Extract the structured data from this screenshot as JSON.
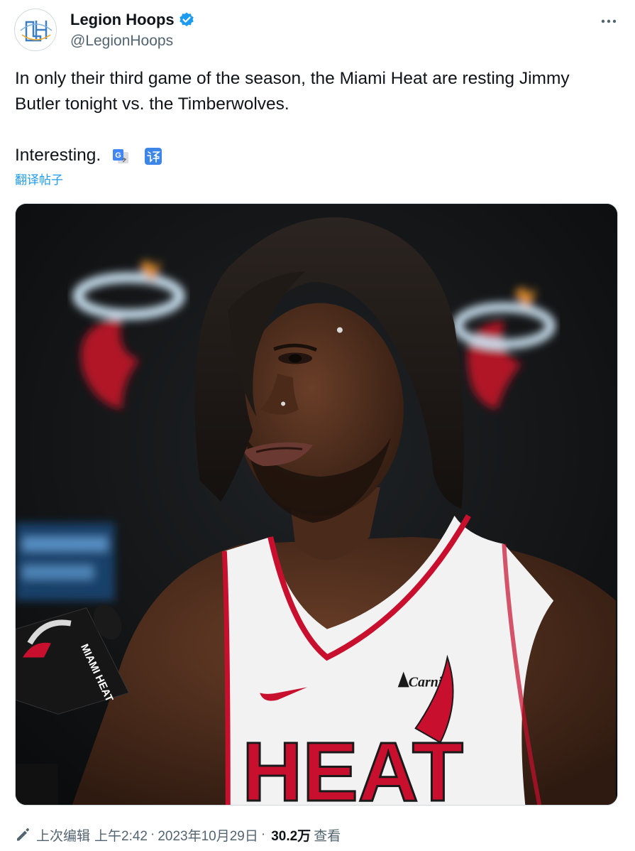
{
  "tweet": {
    "author": {
      "display_name": "Legion Hoops",
      "handle": "@LegionHoops",
      "avatar_text": "LH",
      "verified": true
    },
    "text_line1": "In only their third game of the season, the Miami Heat are resting Jimmy Butler tonight vs. the Timberwolves.",
    "text_line2": "Interesting.",
    "translate_link": "翻译帖子",
    "image_text": {
      "mic_flag": "MIAMI HEAT",
      "jersey_sponsor": "Carniv",
      "jersey_wordmark": "HEAT"
    },
    "meta": {
      "edited_label": "上次编辑",
      "time": "上午2:42",
      "dot": "·",
      "date": "2023年10月29日",
      "views_count": "30.2万",
      "views_label": "查看"
    }
  },
  "icons": {
    "verified": "verified-badge-icon",
    "more": "more-dots-icon",
    "google_translate": "google-translate-icon",
    "translate": "translate-icon",
    "edit": "pencil-icon"
  },
  "colors": {
    "accent": "#1d9bf0",
    "text": "#0f1419",
    "secondary": "#536471",
    "heat_red": "#c8102e"
  }
}
